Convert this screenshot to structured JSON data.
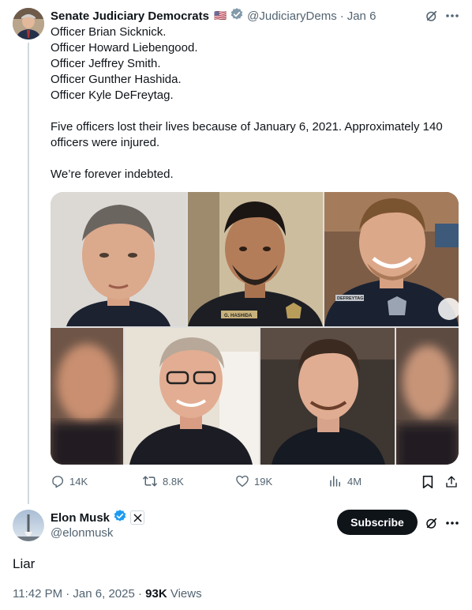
{
  "tweet": {
    "author_name": "Senate Judiciary Democrats",
    "flag": "🇺🇸",
    "handle": "@JudiciaryDems",
    "separator": "·",
    "date": "Jan 6",
    "lines": [
      "Officer Brian Sicknick.",
      "Officer Howard Liebengood.",
      "Officer Jeffrey Smith.",
      "Officer Gunther Hashida.",
      "Officer Kyle DeFreytag."
    ],
    "paragraph2": "Five officers lost their lives because of January 6, 2021. Approximately 140 officers were injured.",
    "paragraph3": "We’re forever indebted.",
    "photo_badges": [
      "G. HASHIDA",
      "DEFREYTAG"
    ],
    "stats": {
      "replies": "14K",
      "reposts": "8.8K",
      "likes": "19K",
      "views": "4M"
    }
  },
  "reply": {
    "author_name": "Elon Musk",
    "handle": "@elonmusk",
    "subscribe_label": "Subscribe",
    "text": "Liar",
    "time": "11:42 PM · Jan 6, 2025 · ",
    "views_count": "93K",
    "views_label": " Views"
  },
  "colors": {
    "accent": "#1d9bf0",
    "text": "#0f1419",
    "muted": "#536471",
    "thread_line": "#cfd9de",
    "verified_gray": "#829aab"
  },
  "icons": [
    "grok-icon",
    "more-icon",
    "reply-icon",
    "repost-icon",
    "like-icon",
    "views-icon",
    "bookmark-icon",
    "share-icon",
    "verified-badge-icon",
    "x-logo-icon"
  ]
}
